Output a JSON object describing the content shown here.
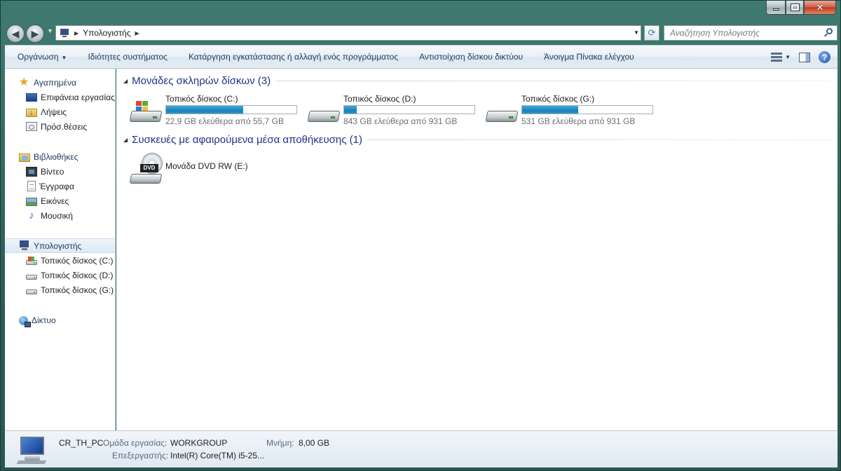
{
  "window": {
    "caption_close": "✕"
  },
  "address": {
    "path": [
      "Υπολογιστής"
    ],
    "search_placeholder": "Αναζήτηση Υπολογιστής"
  },
  "toolbar": {
    "items": [
      {
        "label": "Οργάνωση",
        "has_dropdown": true
      },
      {
        "label": "Ιδιότητες συστήματος"
      },
      {
        "label": "Κατάργηση εγκατάστασης ή αλλαγή ενός προγράμματος"
      },
      {
        "label": "Αντιστοίχιση δίσκου δικτύου"
      },
      {
        "label": "Άνοιγμα Πίνακα ελέγχου"
      }
    ],
    "help": "?"
  },
  "sidebar": {
    "favorites": {
      "label": "Αγαπημένα",
      "icon": "star-icon",
      "items": [
        {
          "label": "Επιφάνεια εργασίας",
          "icon": "desktop-icon"
        },
        {
          "label": "Λήψεις",
          "icon": "downloads-folder-icon"
        },
        {
          "label": "Πρόσ.θέσεις",
          "icon": "recent-places-icon"
        }
      ]
    },
    "libraries": {
      "label": "Βιβλιοθήκες",
      "icon": "libraries-icon",
      "items": [
        {
          "label": "Βίντεο",
          "icon": "video-icon"
        },
        {
          "label": "Έγγραφα",
          "icon": "documents-icon"
        },
        {
          "label": "Εικόνες",
          "icon": "pictures-icon"
        },
        {
          "label": "Μουσική",
          "icon": "music-icon"
        }
      ]
    },
    "computer": {
      "label": "Υπολογιστής",
      "icon": "computer-icon",
      "selected": true,
      "items": [
        {
          "label": "Τοπικός δίσκος (C:)",
          "icon": "system-drive-icon"
        },
        {
          "label": "Τοπικός δίσκος (D:)",
          "icon": "hard-drive-icon"
        },
        {
          "label": "Τοπικός δίσκος (G:)",
          "icon": "hard-drive-icon"
        }
      ]
    },
    "network": {
      "label": "Δίκτυο",
      "icon": "network-icon"
    }
  },
  "content": {
    "hard_drives": {
      "title": "Μονάδες σκληρών δίσκων (3)",
      "drives": [
        {
          "name": "Τοπικός δίσκος (C:)",
          "free_text": "22,9 GB ελεύθερα από 55,7 GB",
          "used_fraction": 0.589,
          "system": true
        },
        {
          "name": "Τοπικός δίσκος (D:)",
          "free_text": "843 GB ελεύθερα από 931 GB",
          "used_fraction": 0.095,
          "system": false
        },
        {
          "name": "Τοπικός δίσκος (G:)",
          "free_text": "531 GB ελεύθερα από 931 GB",
          "used_fraction": 0.43,
          "system": false
        }
      ]
    },
    "removable": {
      "title": "Συσκευές με αφαιρούμενα μέσα αποθήκευσης (1)",
      "devices": [
        {
          "name": "Μονάδα DVD RW (E:)",
          "badge": "DVD"
        }
      ]
    }
  },
  "details": {
    "computer_name": "CR_TH_PC",
    "workgroup_label": "Ομάδα εργασίας:",
    "workgroup_value": "WORKGROUP",
    "memory_label": "Μνήμη:",
    "memory_value": "8,00 GB",
    "processor_label": "Επεξεργαστής:",
    "processor_value": "Intel(R) Core(TM) i5-25..."
  },
  "colors": {
    "frame": "#2d5d56",
    "group_title": "#1e3287",
    "bar_fill": "#1a7fbd"
  }
}
